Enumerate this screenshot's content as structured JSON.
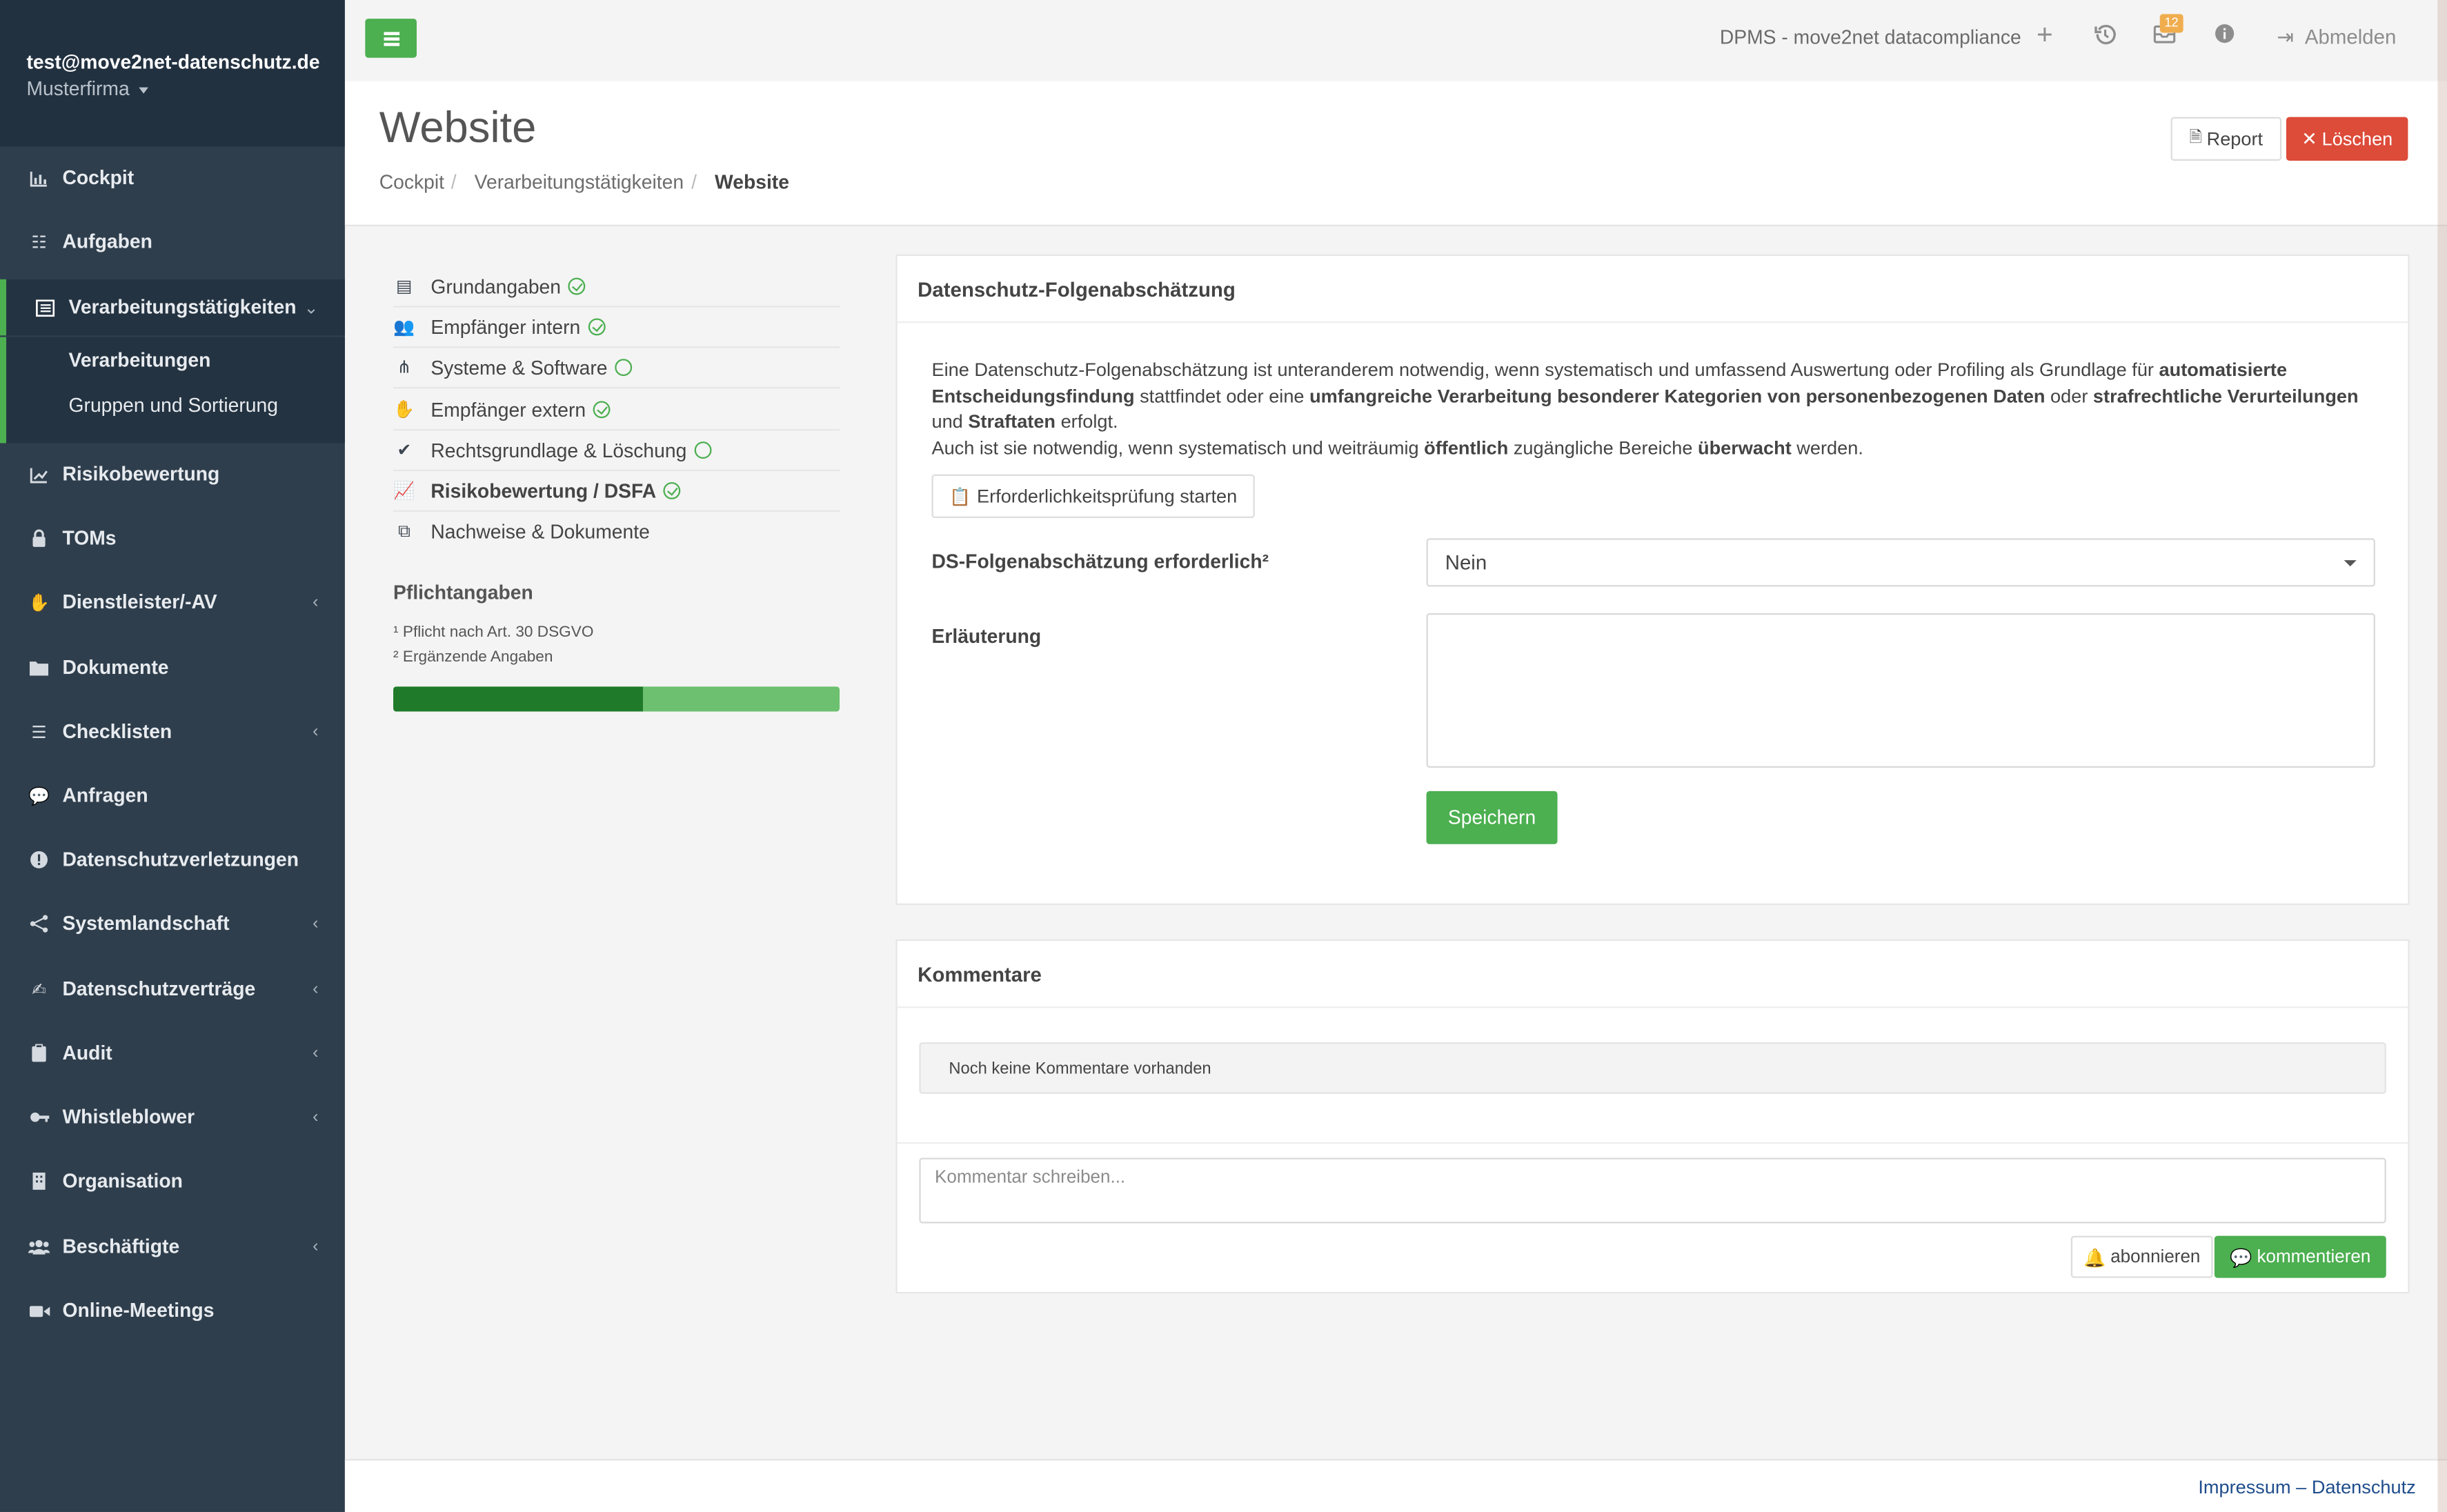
{
  "user": {
    "email": "test@move2net-datenschutz.de",
    "company": "Musterfirma"
  },
  "sidebar": {
    "items": [
      {
        "label": "Cockpit",
        "icon": "chart-bar-icon"
      },
      {
        "label": "Aufgaben",
        "icon": "tasks-icon"
      },
      {
        "label": "Verarbeitungstätigkeiten",
        "icon": "list-alt-icon"
      },
      {
        "label": "Risikobewertung",
        "icon": "chart-line-icon"
      },
      {
        "label": "TOMs",
        "icon": "lock-icon"
      },
      {
        "label": "Dienstleister/-AV",
        "icon": "handshake-icon"
      },
      {
        "label": "Dokumente",
        "icon": "folder-icon"
      },
      {
        "label": "Checklisten",
        "icon": "list-icon"
      },
      {
        "label": "Anfragen",
        "icon": "comments-icon"
      },
      {
        "label": "Datenschutzverletzungen",
        "icon": "exclamation-circle-icon"
      },
      {
        "label": "Systemlandschaft",
        "icon": "project-diagram-icon"
      },
      {
        "label": "Datenschutzverträge",
        "icon": "file-signature-icon"
      },
      {
        "label": "Audit",
        "icon": "clipboard-icon"
      },
      {
        "label": "Whistleblower",
        "icon": "key-icon"
      },
      {
        "label": "Organisation",
        "icon": "building-icon"
      },
      {
        "label": "Beschäftigte",
        "icon": "users-icon"
      },
      {
        "label": "Online-Meetings",
        "icon": "video-icon"
      }
    ],
    "subitems": [
      {
        "label": "Verarbeitungen"
      },
      {
        "label": "Gruppen und Sortierung"
      }
    ]
  },
  "topbar": {
    "app_title": "DPMS - move2net datacompliance",
    "badge_count": "12",
    "logout_label": "Abmelden"
  },
  "header": {
    "title": "Website",
    "breadcrumb": [
      "Cockpit",
      "Verarbeitungstätigkeiten",
      "Website"
    ],
    "report_label": "Report",
    "delete_label": "Löschen"
  },
  "steps": [
    {
      "label": "Grundangaben",
      "icon": "list-alt-icon",
      "status": "complete"
    },
    {
      "label": "Empfänger intern",
      "icon": "users-icon",
      "status": "complete"
    },
    {
      "label": "Systeme & Software",
      "icon": "project-diagram-icon",
      "status": "open"
    },
    {
      "label": "Empfänger extern",
      "icon": "handshake-icon",
      "status": "complete"
    },
    {
      "label": "Rechtsgrundlage & Löschung",
      "icon": "check-circle-icon",
      "status": "open"
    },
    {
      "label": "Risikobewertung / DSFA",
      "icon": "chart-line-icon",
      "status": "complete"
    },
    {
      "label": "Nachweise & Dokumente",
      "icon": "copy-icon",
      "status": "none"
    }
  ],
  "pflicht": {
    "title": "Pflichtangaben",
    "note1": "¹ Pflicht nach Art. 30 DSGVO",
    "note2": "² Ergänzende Angaben",
    "progress_fraction": 0.56
  },
  "dsfa": {
    "title": "Datenschutz-Folgenabschätzung",
    "intro_parts": {
      "p1": "Eine Datenschutz-Folgenabschätzung ist unteranderem notwendig, wenn systematisch und umfassend Auswertung oder Profiling als Grundlage für ",
      "b1": "automatisierte Entscheidungsfindung",
      "p2": " stattfindet oder eine ",
      "b2": "umfangreiche Verarbeitung besonderer Kategorien von personenbezogenen Daten",
      "p3": " oder ",
      "b3": "strafrechtliche Verurteilungen",
      "p4": " und ",
      "b4": "Straftaten",
      "p5": " erfolgt.",
      "p6": "Auch ist sie notwendig, wenn systematisch und weiträumig ",
      "b5": "öffentlich",
      "p7": " zugängliche Bereiche ",
      "b6": "überwacht",
      "p8": " werden."
    },
    "check_button": "Erforderlichkeitsprüfung starten",
    "required_label": "DS-Folgenabschätzung erforderlich²",
    "required_value": "Nein",
    "explanation_label": "Erläuterung",
    "save_label": "Speichern"
  },
  "comments": {
    "title": "Kommentare",
    "empty_text": "Noch keine Kommentare vorhanden",
    "placeholder": "Kommentar schreiben...",
    "subscribe_label": "abonnieren",
    "comment_label": "kommentieren"
  },
  "footer": {
    "impressum": "Impressum",
    "separator": "–",
    "datenschutz": "Datenschutz"
  }
}
